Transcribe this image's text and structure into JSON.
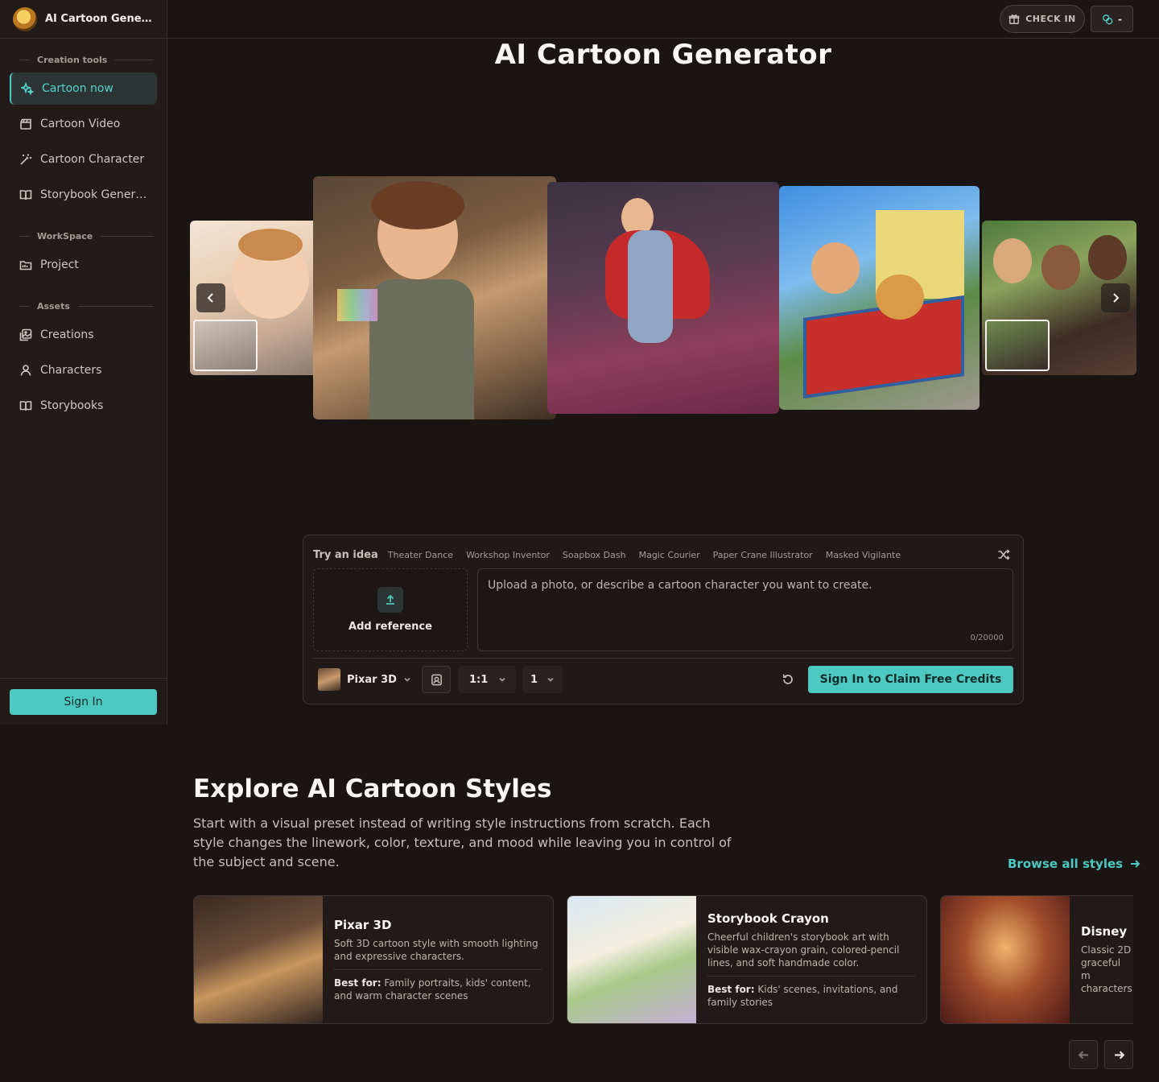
{
  "app": {
    "title": "AI Cartoon Gener...",
    "logo_icon": "cartoon-character-logo"
  },
  "sidebar": {
    "sections": [
      {
        "title": "Creation tools",
        "items": [
          {
            "label": "Cartoon now",
            "icon": "sparkles-icon",
            "active": true
          },
          {
            "label": "Cartoon Video",
            "icon": "clapperboard-icon",
            "active": false
          },
          {
            "label": "Cartoon Character",
            "icon": "magic-wand-icon",
            "active": false
          },
          {
            "label": "Storybook Genera...",
            "icon": "book-open-icon",
            "active": false
          }
        ]
      },
      {
        "title": "WorkSpace",
        "items": [
          {
            "label": "Project",
            "icon": "folder-icon",
            "active": false
          }
        ]
      },
      {
        "title": "Assets",
        "items": [
          {
            "label": "Creations",
            "icon": "images-icon",
            "active": false
          },
          {
            "label": "Characters",
            "icon": "user-icon",
            "active": false
          },
          {
            "label": "Storybooks",
            "icon": "book-open-icon",
            "active": false
          }
        ]
      }
    ],
    "sign_in_label": "Sign In"
  },
  "topbar": {
    "check_in_label": "CHECK IN",
    "credits_value": "-"
  },
  "hero": {
    "title": "AI Cartoon Generator"
  },
  "prompt_panel": {
    "ideas_lead": "Try an idea",
    "ideas": [
      "Theater Dance",
      "Workshop Inventor",
      "Soapbox Dash",
      "Magic Courier",
      "Paper Crane Illustrator",
      "Masked Vigilante"
    ],
    "add_reference_label": "Add reference",
    "placeholder": "Upload a photo, or describe a cartoon character you want to create.",
    "counter": "0/20000",
    "style_label": "Pixar 3D",
    "aspect_ratio": "1:1",
    "count": "1",
    "claim_label": "Sign In to Claim Free Credits"
  },
  "explore": {
    "title": "Explore AI Cartoon Styles",
    "description": "Start with a visual preset instead of writing style instructions from scratch. Each style changes the linework, color, texture, and mood while leaving you in control of the subject and scene.",
    "browse_label": "Browse all styles",
    "best_for_label": "Best for:",
    "cards": [
      {
        "name": "Pixar 3D",
        "description": "Soft 3D cartoon style with smooth lighting and expressive characters.",
        "best_for": "Family portraits, kids' content, and warm character scenes"
      },
      {
        "name": "Storybook Crayon",
        "description": "Cheerful children's storybook art with visible wax-crayon grain, colored-pencil lines, and soft handmade color.",
        "best_for": "Kids' scenes, invitations, and family stories"
      },
      {
        "name": "Disney",
        "description": "Classic 2D graceful m characters",
        "best_for": ""
      }
    ]
  },
  "colors": {
    "accent": "#4ec9c2",
    "background": "#1a1413",
    "sidebar": "#221b19"
  }
}
